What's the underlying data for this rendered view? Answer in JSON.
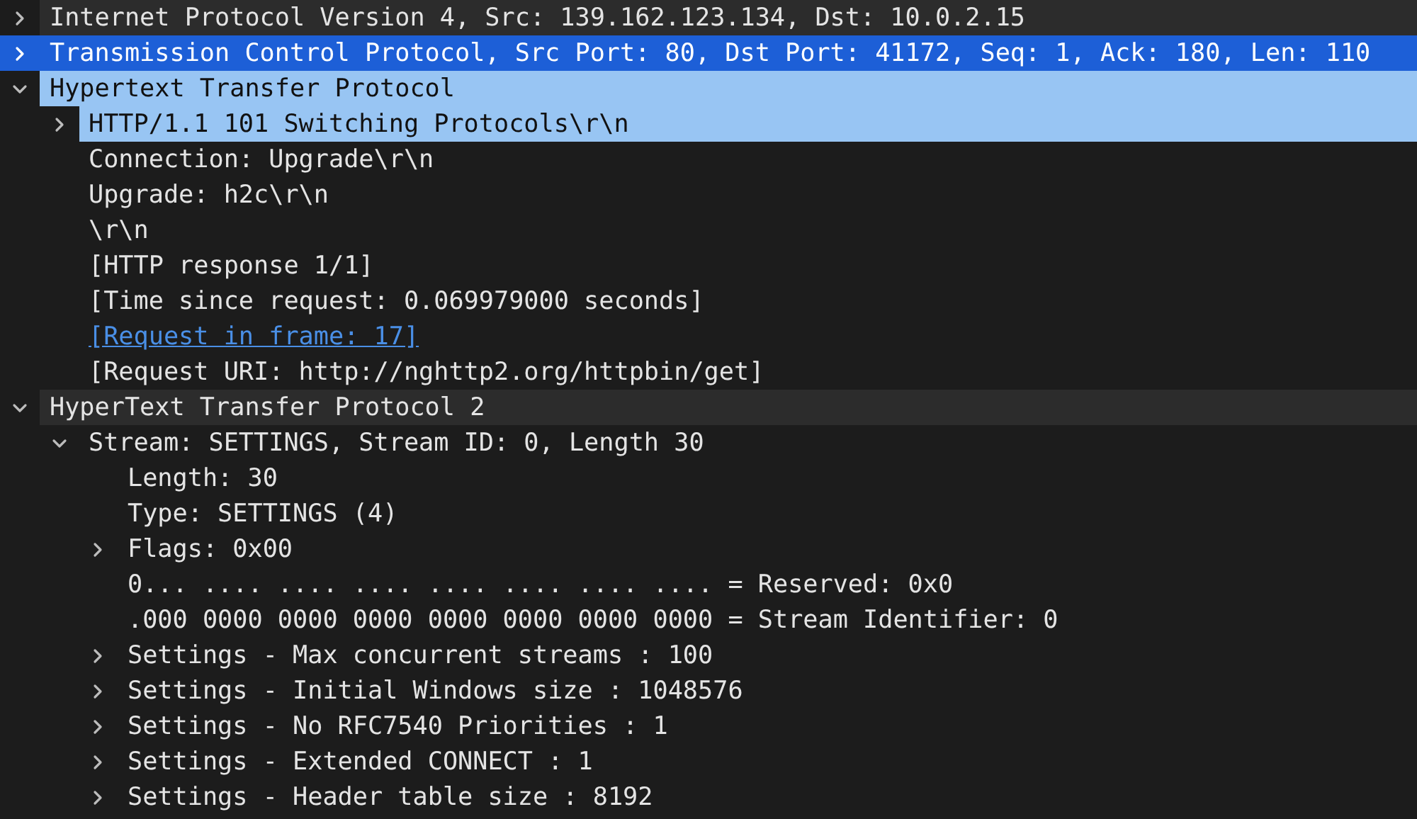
{
  "tree": [
    {
      "label": "Internet Protocol Version 4, Src: 139.162.123.134, Dst: 10.0.2.15",
      "expanded": false,
      "selected": false,
      "highlighted": false
    },
    {
      "label": "Transmission Control Protocol, Src Port: 80, Dst Port: 41172, Seq: 1, Ack: 180, Len: 110",
      "expanded": false,
      "selected": true,
      "highlighted": false
    },
    {
      "label": "Hypertext Transfer Protocol",
      "expanded": true,
      "selected": false,
      "highlighted": true,
      "children": [
        {
          "label": "HTTP/1.1 101 Switching Protocols\\r\\n",
          "expanded": false,
          "selected": false,
          "highlighted": true
        },
        {
          "label": "Connection: Upgrade\\r\\n",
          "selected": false,
          "highlighted": false
        },
        {
          "label": "Upgrade: h2c\\r\\n",
          "selected": false,
          "highlighted": false
        },
        {
          "label": "\\r\\n",
          "selected": false,
          "highlighted": false
        },
        {
          "label": "[HTTP response 1/1]",
          "selected": false,
          "highlighted": false
        },
        {
          "label": "[Time since request: 0.069979000 seconds]",
          "selected": false,
          "highlighted": false
        },
        {
          "label": "[Request in frame: 17]",
          "link": true,
          "selected": false,
          "highlighted": false
        },
        {
          "label": "[Request URI: http://nghttp2.org/httpbin/get]",
          "selected": false,
          "highlighted": false
        }
      ]
    },
    {
      "label": "HyperText Transfer Protocol 2",
      "expanded": true,
      "selected": false,
      "highlighted": false,
      "children": [
        {
          "label": "Stream: SETTINGS, Stream ID: 0, Length 30",
          "expanded": true,
          "selected": false,
          "highlighted": false,
          "children": [
            {
              "label": "Length: 30",
              "selected": false,
              "highlighted": false
            },
            {
              "label": "Type: SETTINGS (4)",
              "selected": false,
              "highlighted": false
            },
            {
              "label": "Flags: 0x00",
              "expanded": false,
              "selected": false,
              "highlighted": false
            },
            {
              "label": "0... .... .... .... .... .... .... .... = Reserved: 0x0",
              "selected": false,
              "highlighted": false
            },
            {
              "label": ".000 0000 0000 0000 0000 0000 0000 0000 = Stream Identifier: 0",
              "selected": false,
              "highlighted": false
            },
            {
              "label": "Settings - Max concurrent streams : 100",
              "expanded": false,
              "selected": false,
              "highlighted": false
            },
            {
              "label": "Settings - Initial Windows size : 1048576",
              "expanded": false,
              "selected": false,
              "highlighted": false
            },
            {
              "label": "Settings - No RFC7540 Priorities : 1",
              "expanded": false,
              "selected": false,
              "highlighted": false
            },
            {
              "label": "Settings - Extended CONNECT : 1",
              "expanded": false,
              "selected": false,
              "highlighted": false
            },
            {
              "label": "Settings - Header table size : 8192",
              "expanded": false,
              "selected": false,
              "highlighted": false
            }
          ]
        }
      ]
    }
  ]
}
